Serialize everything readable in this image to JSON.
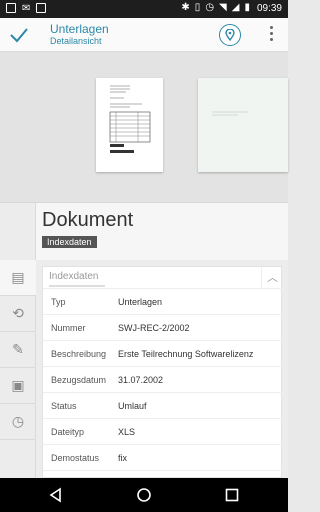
{
  "status_bar": {
    "time": "09:39"
  },
  "app_bar": {
    "title": "Unterlagen",
    "subtitle": "Detailansicht"
  },
  "document": {
    "title": "Dokument",
    "badge": "Indexdaten"
  },
  "section": {
    "label": "Indexdaten"
  },
  "fields": [
    {
      "key": "Typ",
      "value": "Unterlagen"
    },
    {
      "key": "Nummer",
      "value": "SWJ-REC-2/2002"
    },
    {
      "key": "Beschreibung",
      "value": "Erste Teilrechnung Softwarelizenz"
    },
    {
      "key": "Bezugsdatum",
      "value": "31.07.2002"
    },
    {
      "key": "Status",
      "value": "Umlauf"
    },
    {
      "key": "Dateityp",
      "value": "XLS"
    },
    {
      "key": "Demostatus",
      "value": "fix"
    }
  ],
  "colors": {
    "accent": "#2b88a8",
    "status_bar": "#1e1e1e",
    "badge": "#555555"
  }
}
